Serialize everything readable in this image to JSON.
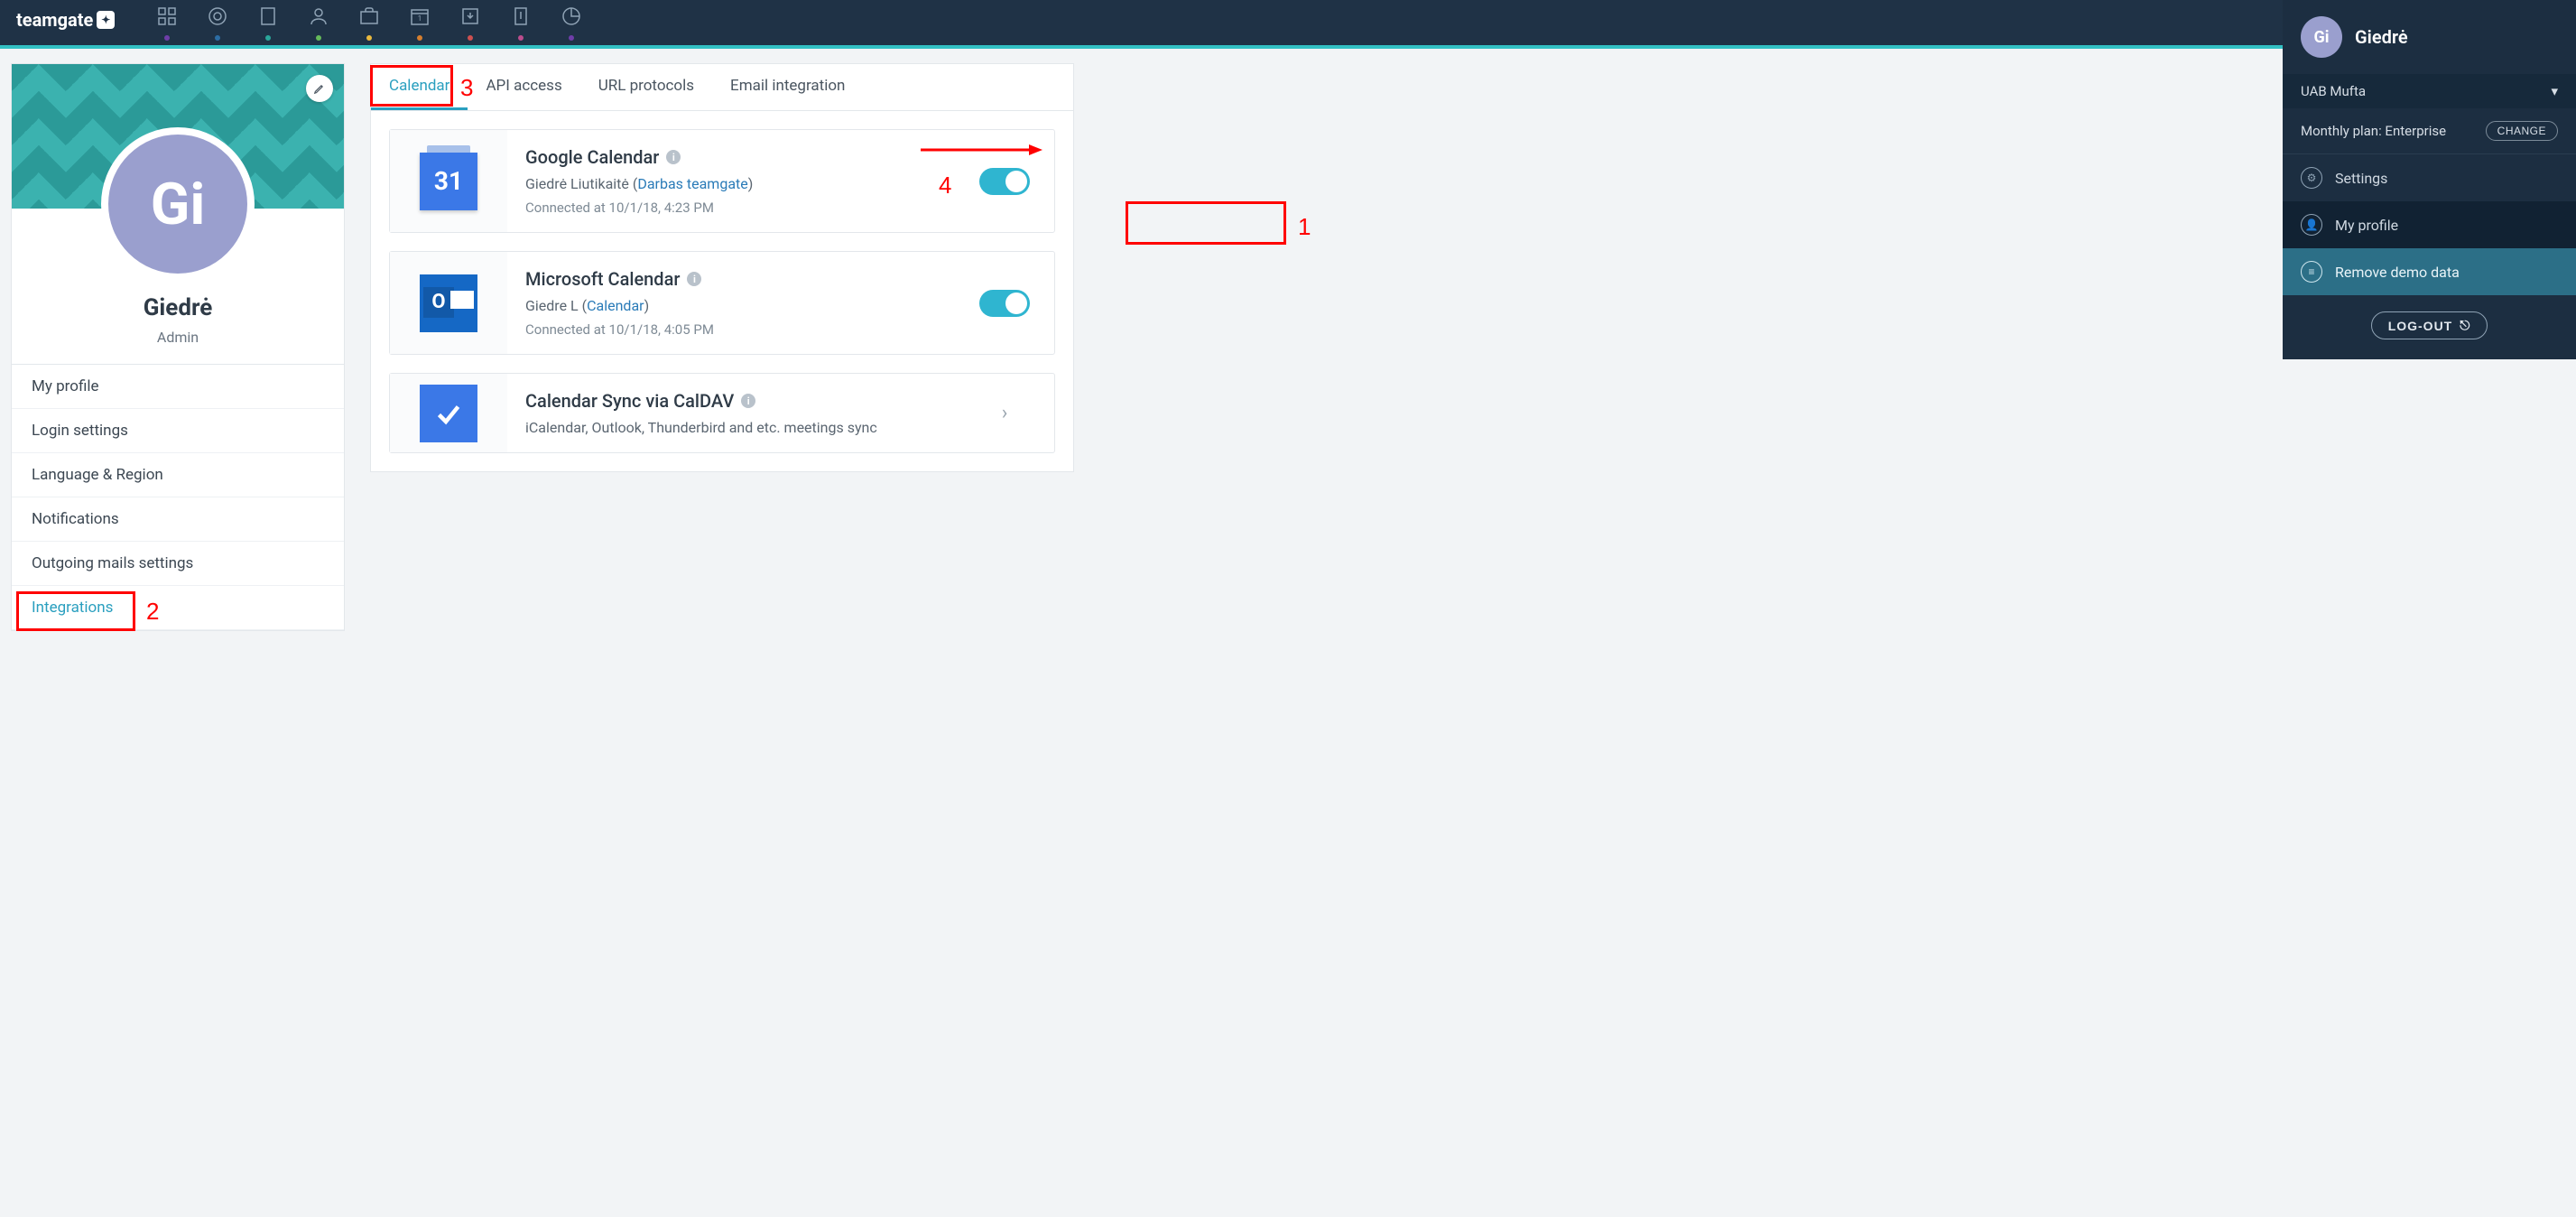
{
  "brand": "teamgate",
  "topnav_dots": [
    "#6f3ea9",
    "#2c6da4",
    "#2aa69a",
    "#65ba5a",
    "#e9b93e",
    "#d67f2e",
    "#cd5050",
    "#bb4d8d",
    "#6f3ea9"
  ],
  "profile": {
    "initials": "Gi",
    "name": "Giedrė",
    "role": "Admin"
  },
  "side_menu": {
    "items": [
      {
        "label": "My profile"
      },
      {
        "label": "Login settings"
      },
      {
        "label": "Language & Region"
      },
      {
        "label": "Notifications"
      },
      {
        "label": "Outgoing mails settings"
      },
      {
        "label": "Integrations",
        "active": true
      }
    ]
  },
  "tabs": [
    {
      "label": "Calendar",
      "active": true
    },
    {
      "label": "API access"
    },
    {
      "label": "URL protocols"
    },
    {
      "label": "Email integration"
    }
  ],
  "integrations": {
    "gcal": {
      "title": "Google Calendar",
      "user": "Giedrė Liutikaitė (",
      "link": "Darbas teamgate",
      "close": ")",
      "connected": "Connected at 10/1/18, 4:23 PM",
      "icon_num": "31"
    },
    "ms": {
      "title": "Microsoft Calendar",
      "user": "Giedre L (",
      "link": "Calendar",
      "close": ")",
      "connected": "Connected at 10/1/18, 4:05 PM"
    },
    "caldav": {
      "title": "Calendar Sync via CalDAV",
      "desc": "iCalendar, Outlook, Thunderbird and etc. meetings sync"
    }
  },
  "right_panel": {
    "initials": "Gi",
    "name": "Giedrė",
    "org": "UAB Mufta",
    "plan_label": "Monthly plan: Enterprise",
    "change": "CHANGE",
    "settings": "Settings",
    "my_profile": "My profile",
    "remove_demo": "Remove demo data",
    "logout": "LOG-OUT"
  },
  "annotations": {
    "n1": "1",
    "n2": "2",
    "n3": "3",
    "n4": "4"
  }
}
